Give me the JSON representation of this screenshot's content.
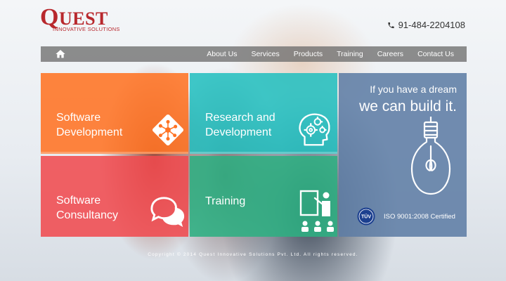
{
  "header": {
    "logo_brand": "QUEST",
    "logo_sub": "INNOVATIVE SOLUTIONS",
    "phone": "91-484-2204108"
  },
  "nav": {
    "items": [
      "About Us",
      "Services",
      "Products",
      "Training",
      "Careers",
      "Contact Us"
    ]
  },
  "tiles": {
    "software_development": {
      "line1": "Software",
      "line2": "Development"
    },
    "research_development": {
      "line1": "Research and",
      "line2": "Development"
    },
    "software_consultancy": {
      "line1": "Software",
      "line2": "Consultancy"
    },
    "training": {
      "line1": "Training"
    },
    "dream": {
      "line1": "If you have a dream",
      "line2": "we can build it.",
      "badge_text": "TÜV",
      "certification": "ISO 9001:2008 Certified"
    }
  },
  "footer": {
    "copyright": "Copyright © 2014 Quest Innovative Solutions Pvt. Ltd. All rights reserved."
  },
  "colors": {
    "brand": "#b8282d",
    "orange": "#ff7323",
    "teal": "#1ebebe",
    "red": "#f04b50",
    "green": "#2daf82",
    "blue": "#5f7da5"
  }
}
